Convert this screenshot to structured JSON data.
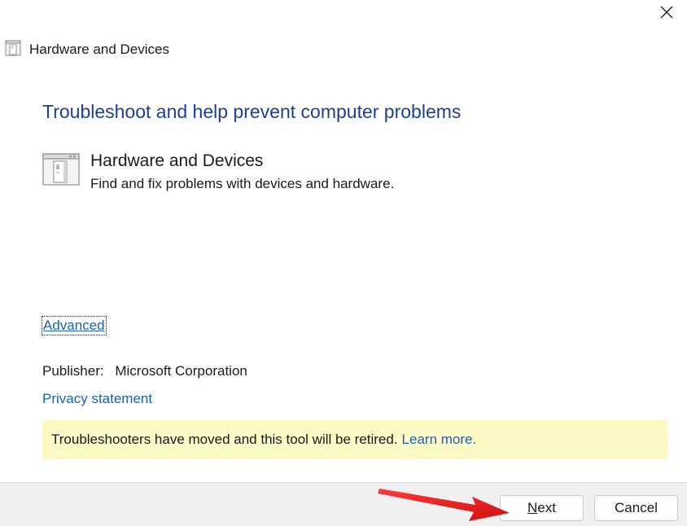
{
  "window": {
    "title": "Hardware and Devices",
    "close_icon": "close-icon"
  },
  "main": {
    "heading": "Troubleshoot and help prevent computer problems",
    "entry": {
      "icon": "hardware-devices-icon",
      "title": "Hardware and Devices",
      "description": "Find and fix problems with devices and hardware."
    },
    "advanced_label": "Advanced",
    "publisher_label": "Publisher:",
    "publisher_value": "Microsoft Corporation",
    "privacy_label": "Privacy statement"
  },
  "notice": {
    "text": "Troubleshooters have moved and this tool will be retired.",
    "link": "Learn more."
  },
  "footer": {
    "next_first": "N",
    "next_rest": "ext",
    "cancel_label": "Cancel"
  },
  "colors": {
    "heading": "#1c3f94",
    "link": "#1a5fb4",
    "notice_bg": "#fcf9c5",
    "footer_bg": "#f0f0f0",
    "annotation": "#e81c1c"
  }
}
